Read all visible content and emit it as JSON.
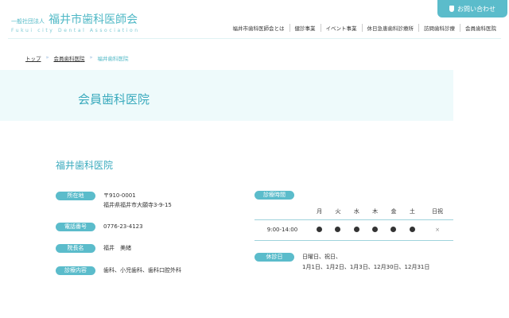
{
  "header": {
    "org_type": "一般社団法人",
    "org_name": "福井市歯科医師会",
    "org_en": "Fukui city Dental Association",
    "contact": "お問い合わせ"
  },
  "nav": [
    "福井市歯科医師会とは",
    "健診事業",
    "イベント事業",
    "休日急患歯科診療所",
    "訪問歯科診療",
    "会員歯科医院"
  ],
  "breadcrumb": {
    "home": "トップ",
    "parent": "会員歯科医院",
    "current": "福井歯科医院",
    "sep": "»"
  },
  "page_title": "会員歯科医院",
  "clinic": {
    "name": "福井歯科医院",
    "info": [
      {
        "label": "所在地",
        "lines": [
          "〒910-0001",
          "福井県福井市大願寺3-9-15"
        ]
      },
      {
        "label": "電話番号",
        "lines": [
          "0776-23-4123"
        ]
      },
      {
        "label": "院長名",
        "lines": [
          "福井　美緒"
        ]
      },
      {
        "label": "診療内容",
        "lines": [
          "歯科、小児歯科、歯科口腔外科"
        ]
      }
    ],
    "hours_label": "診療時間",
    "days": [
      "月",
      "火",
      "水",
      "木",
      "金",
      "土",
      "日祝"
    ],
    "hours": {
      "time": "9:00-14:00",
      "open": [
        true,
        true,
        true,
        true,
        true,
        true,
        false
      ],
      "closed_mark": "×"
    },
    "holiday_label": "休診日",
    "holidays": [
      "日曜日、祝日、",
      "1月1日、1月2日、1月3日、12月30日、12月31日"
    ]
  }
}
